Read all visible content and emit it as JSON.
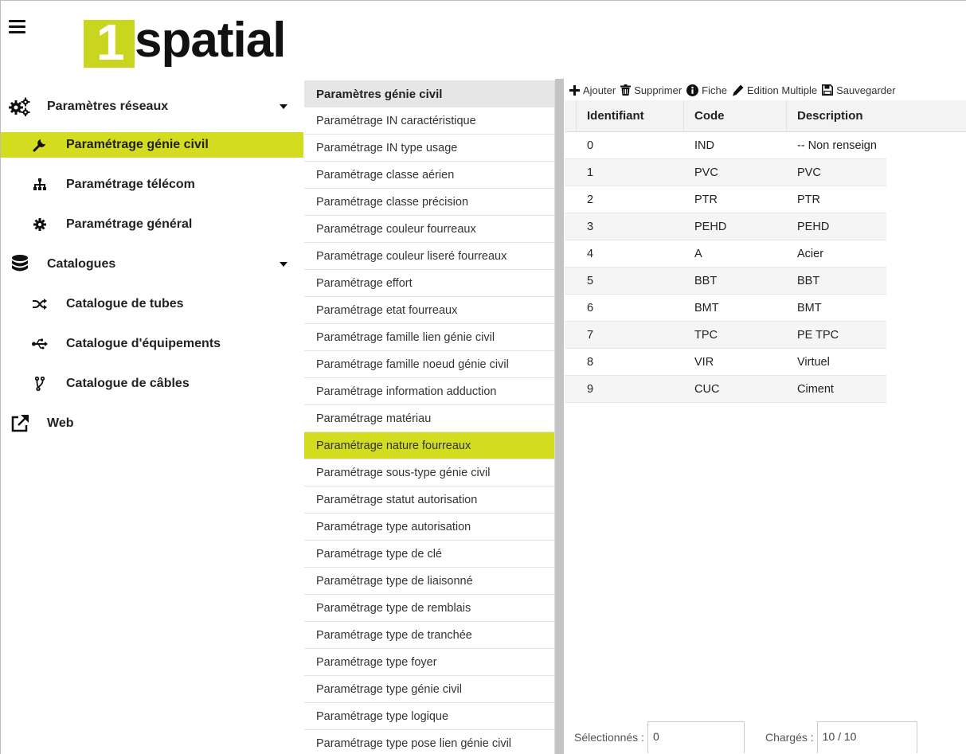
{
  "brand": {
    "logo_number": "1",
    "logo_word": "spatial",
    "accent": "#d3dc1e"
  },
  "sidebar": {
    "items": [
      {
        "label": "Paramètres réseaux",
        "icon": "cogs-icon",
        "level": "group",
        "expanded": true
      },
      {
        "label": "Paramétrage génie civil",
        "icon": "wrench-icon",
        "level": "sub",
        "active": true
      },
      {
        "label": "Paramétrage télécom",
        "icon": "sitemap-icon",
        "level": "sub"
      },
      {
        "label": "Paramétrage général",
        "icon": "gear-icon",
        "level": "sub"
      },
      {
        "label": "Catalogues",
        "icon": "database-icon",
        "level": "group",
        "expanded": true
      },
      {
        "label": "Catalogue de tubes",
        "icon": "random-icon",
        "level": "sub"
      },
      {
        "label": "Catalogue d'équipements",
        "icon": "usb-icon",
        "level": "sub"
      },
      {
        "label": "Catalogue de câbles",
        "icon": "code-fork-icon",
        "level": "sub"
      },
      {
        "label": "Web",
        "icon": "external-link-icon",
        "level": "group"
      }
    ]
  },
  "param_list": {
    "title": "Paramètres génie civil",
    "selected_index": 12,
    "items": [
      "Paramétrage IN caractéristique",
      "Paramétrage IN type usage",
      "Paramétrage classe aérien",
      "Paramétrage classe précision",
      "Paramétrage couleur fourreaux",
      "Paramétrage couleur liseré fourreaux",
      "Paramétrage effort",
      "Paramétrage etat fourreaux",
      "Paramétrage famille lien génie civil",
      "Paramétrage famille noeud génie civil",
      "Paramétrage information adduction",
      "Paramétrage matériau",
      "Paramétrage nature fourreaux",
      "Paramétrage sous-type génie civil",
      "Paramétrage statut autorisation",
      "Paramétrage type autorisation",
      "Paramétrage type de clé",
      "Paramétrage type de liaisonné",
      "Paramétrage type de remblais",
      "Paramétrage type de tranchée",
      "Paramétrage type foyer",
      "Paramétrage type génie civil",
      "Paramétrage type logique",
      "Paramétrage type pose lien génie civil"
    ]
  },
  "toolbar": {
    "add": "Ajouter",
    "delete": "Supprimer",
    "sheet": "Fiche",
    "multi_edit": "Edition Multiple",
    "save": "Sauvegarder"
  },
  "table": {
    "columns": [
      "Identifiant",
      "Code",
      "Description"
    ],
    "rows": [
      [
        "0",
        "IND",
        "-- Non renseign"
      ],
      [
        "1",
        "PVC",
        "PVC"
      ],
      [
        "2",
        "PTR",
        "PTR"
      ],
      [
        "3",
        "PEHD",
        "PEHD"
      ],
      [
        "4",
        "A",
        "Acier"
      ],
      [
        "5",
        "BBT",
        "BBT"
      ],
      [
        "6",
        "BMT",
        "BMT"
      ],
      [
        "7",
        "TPC",
        "PE TPC"
      ],
      [
        "8",
        "VIR",
        "Virtuel"
      ],
      [
        "9",
        "CUC",
        "Ciment"
      ]
    ]
  },
  "footer": {
    "selected_label": "Sélectionnés :",
    "selected_value": "0",
    "loaded_label": "Chargés :",
    "loaded_value": "10 / 10"
  }
}
